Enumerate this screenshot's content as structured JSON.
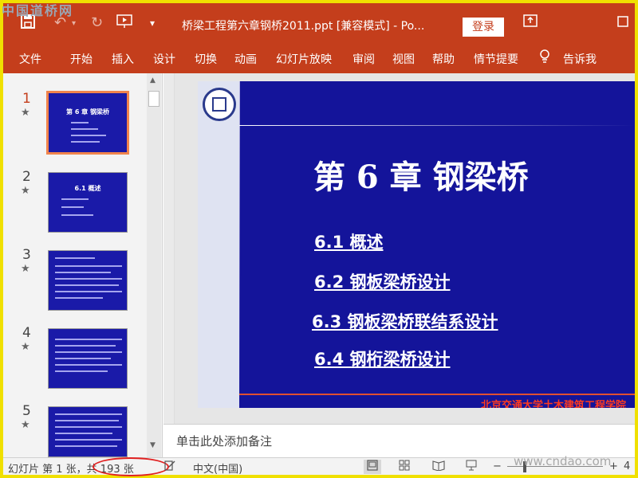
{
  "watermark_top": "中国道桥网",
  "watermark_bottom": "www.cndao.com",
  "titlebar": {
    "save_icon": "save-icon",
    "undo_icon": "undo-icon",
    "redo_icon": "redo-icon",
    "present_icon": "present-from-start-icon",
    "title": "桥梁工程第六章钢桥2011.ppt [兼容模式] - Po...",
    "login_label": "登录",
    "ribbon_display_icon": "ribbon-display-options-icon",
    "maximize_icon": "maximize-icon"
  },
  "ribbon_tabs": [
    "文件",
    "开始",
    "插入",
    "设计",
    "切换",
    "动画",
    "幻灯片放映",
    "审阅",
    "视图",
    "帮助",
    "情节提要"
  ],
  "tell_me": "告诉我",
  "thumbnails": [
    {
      "number": "1",
      "title": "第 6 章 钢梁桥"
    },
    {
      "number": "2",
      "title": "6.1 概述"
    },
    {
      "number": "3",
      "title": ""
    },
    {
      "number": "4",
      "title": ""
    },
    {
      "number": "5",
      "title": ""
    }
  ],
  "slide": {
    "title": "第 6 章  钢梁桥",
    "items": [
      "6.1  概述",
      "6.2  钢板梁桥设计",
      "6.3 钢板梁桥联结系设计",
      "6.4  钢桁梁桥设计"
    ],
    "footer": "北京交通大学土木建筑工程学院"
  },
  "notes_placeholder": "单击此处添加备注",
  "status": {
    "slide_info": "幻灯片 第 1 张，共 193 张",
    "language": "中文(中国)",
    "zoom_partial": "4"
  },
  "colors": {
    "accent": "#c43e1c",
    "slide_bg": "#14149a",
    "frame": "#f0e000"
  }
}
